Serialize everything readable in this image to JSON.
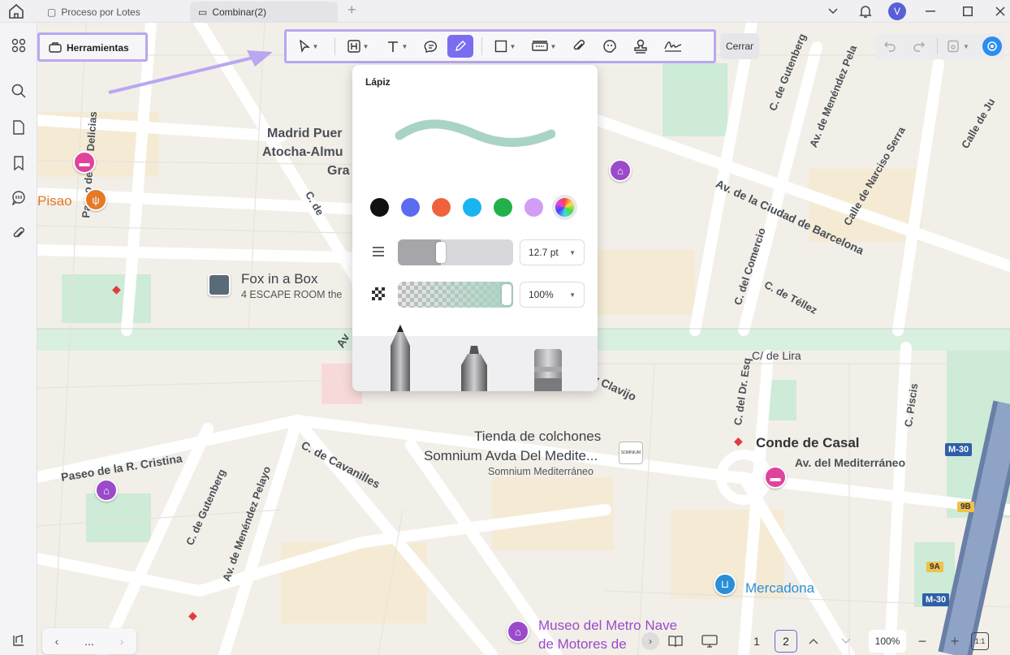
{
  "tabs": [
    {
      "label": "Proceso por Lotes"
    },
    {
      "label": "Combinar(2)"
    }
  ],
  "user": {
    "initial": "V"
  },
  "toolbar": {
    "herramientas": "Herramientas",
    "cerrar": "Cerrar"
  },
  "panel": {
    "title": "Lápiz",
    "stroke_color": "#a9d3c3",
    "colors": [
      "#111111",
      "#5b6cf0",
      "#f0623c",
      "#1ab4f0",
      "#22b04a",
      "#d39cf5"
    ],
    "thickness": {
      "value": "12.7 pt",
      "fraction": 0.37
    },
    "opacity": {
      "value": "100%",
      "fraction": 1.0
    }
  },
  "map": {
    "labels": {
      "madrid1": "Madrid Puer",
      "madrid2": "Atocha-Almu",
      "madrid3": "Gra",
      "pisao": "Pisao",
      "fox": "Fox in a Box",
      "fox_sub": "4 ESCAPE ROOM the",
      "delicias": "Paseo de las Delicias",
      "c_de": "C. de",
      "ciudad_barcelona": "Av. de la Ciudad de Barcelona",
      "narciso": "Calle de Narciso Serra",
      "comercio": "C. del Comercio",
      "tellez": "C. de Téllez",
      "gutenberg_top": "C. de Gutenberg",
      "menendez_top": "Av. de Menéndez Pela",
      "calle_ju": "Calle de Ju",
      "lira": "C/ de Lira",
      "dr_esq": "C. del Dr. Esq",
      "piscis": "C. Piscis",
      "clavijo": "y Clavijo",
      "av": "Av",
      "tienda": "Tienda de colchones",
      "somnium": "Somnium Avda Del Medite...",
      "somnium_sub": "Somnium Mediterráneo",
      "somnium_logo": "SOMNIUM",
      "conde": "Conde de Casal",
      "mediterraneo": "Av. del Mediterráneo",
      "cristina": "Paseo de la R. Cristina",
      "cavanilles": "C. de Cavanilles",
      "gutenberg": "C. de Gutenberg",
      "menendez": "Av. de Menéndez Pelayo",
      "mercadona": "Mercadona",
      "museo1": "Museo del Metro Nave",
      "museo2": "de Motores de",
      "m30a": "M-30",
      "m30b": "M-30",
      "b9": "9B",
      "a9": "9A"
    }
  },
  "bottom": {
    "more": "...",
    "page1": "1",
    "page2": "2",
    "zoom": "100%",
    "fit": "1:1"
  }
}
